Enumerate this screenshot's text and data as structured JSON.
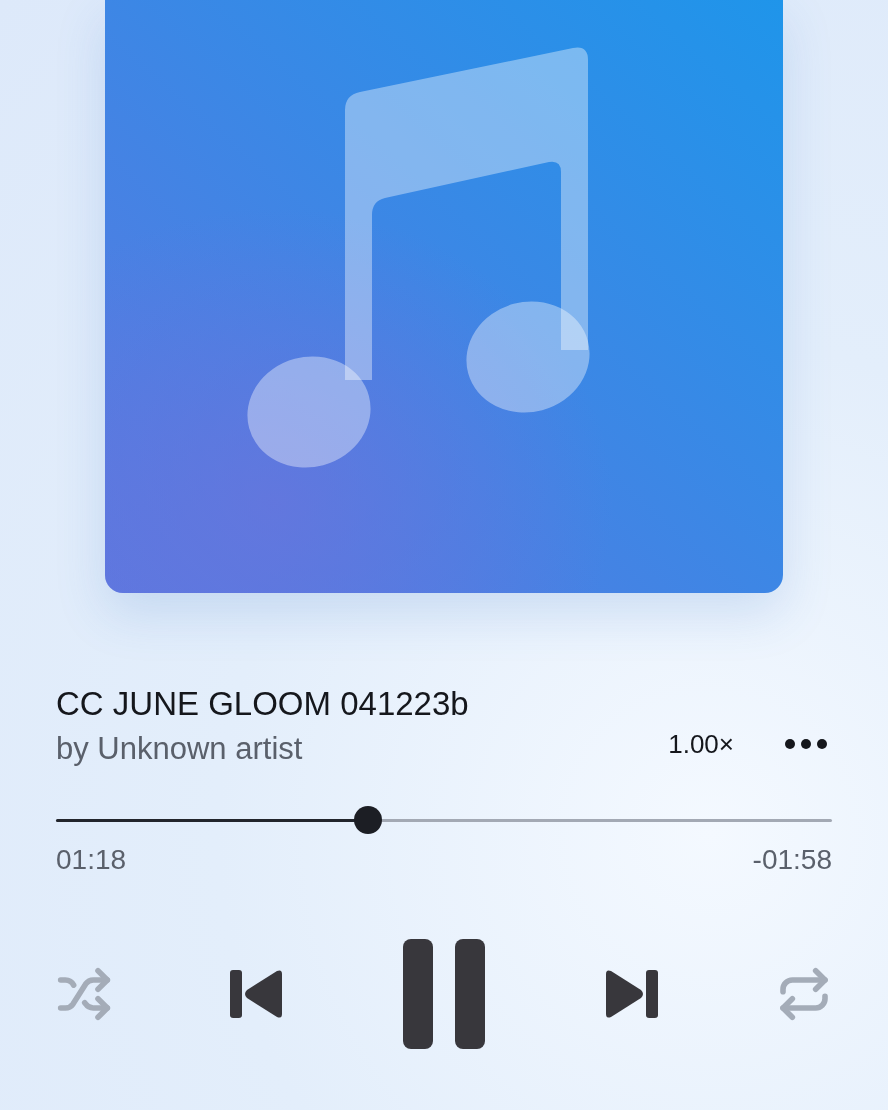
{
  "track": {
    "title": "CC JUNE GLOOM 041223b",
    "artist": "by Unknown artist"
  },
  "speed": "1.00×",
  "progress": {
    "level": 0.402,
    "elapsed": "01:18",
    "remaining": "-01:58"
  },
  "controls": {
    "shuffle": false,
    "playing": true,
    "repeat": false
  }
}
